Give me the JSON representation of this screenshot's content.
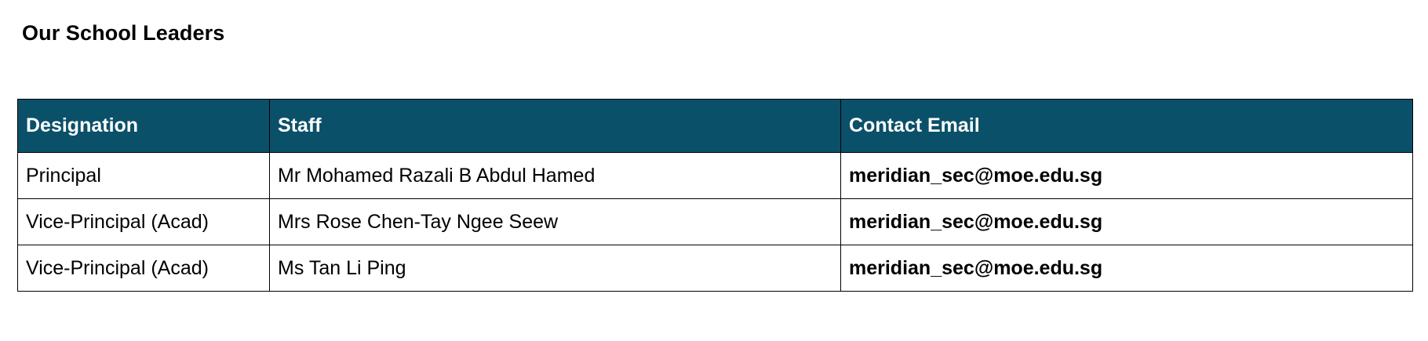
{
  "page": {
    "title": "Our School Leaders"
  },
  "colors": {
    "header_background": "#0b5069",
    "header_text": "#ffffff",
    "border": "#000000"
  },
  "table": {
    "headers": [
      "Designation",
      "Staff",
      "Contact Email"
    ],
    "rows": [
      {
        "designation": "Principal",
        "staff": "Mr Mohamed Razali B Abdul Hamed",
        "email": "meridian_sec@moe.edu.sg"
      },
      {
        "designation": "Vice-Principal (Acad)",
        "staff": "Mrs Rose Chen-Tay Ngee Seew",
        "email": "meridian_sec@moe.edu.sg"
      },
      {
        "designation": "Vice-Principal (Acad)",
        "staff": "Ms Tan Li Ping",
        "email": "meridian_sec@moe.edu.sg"
      }
    ]
  }
}
